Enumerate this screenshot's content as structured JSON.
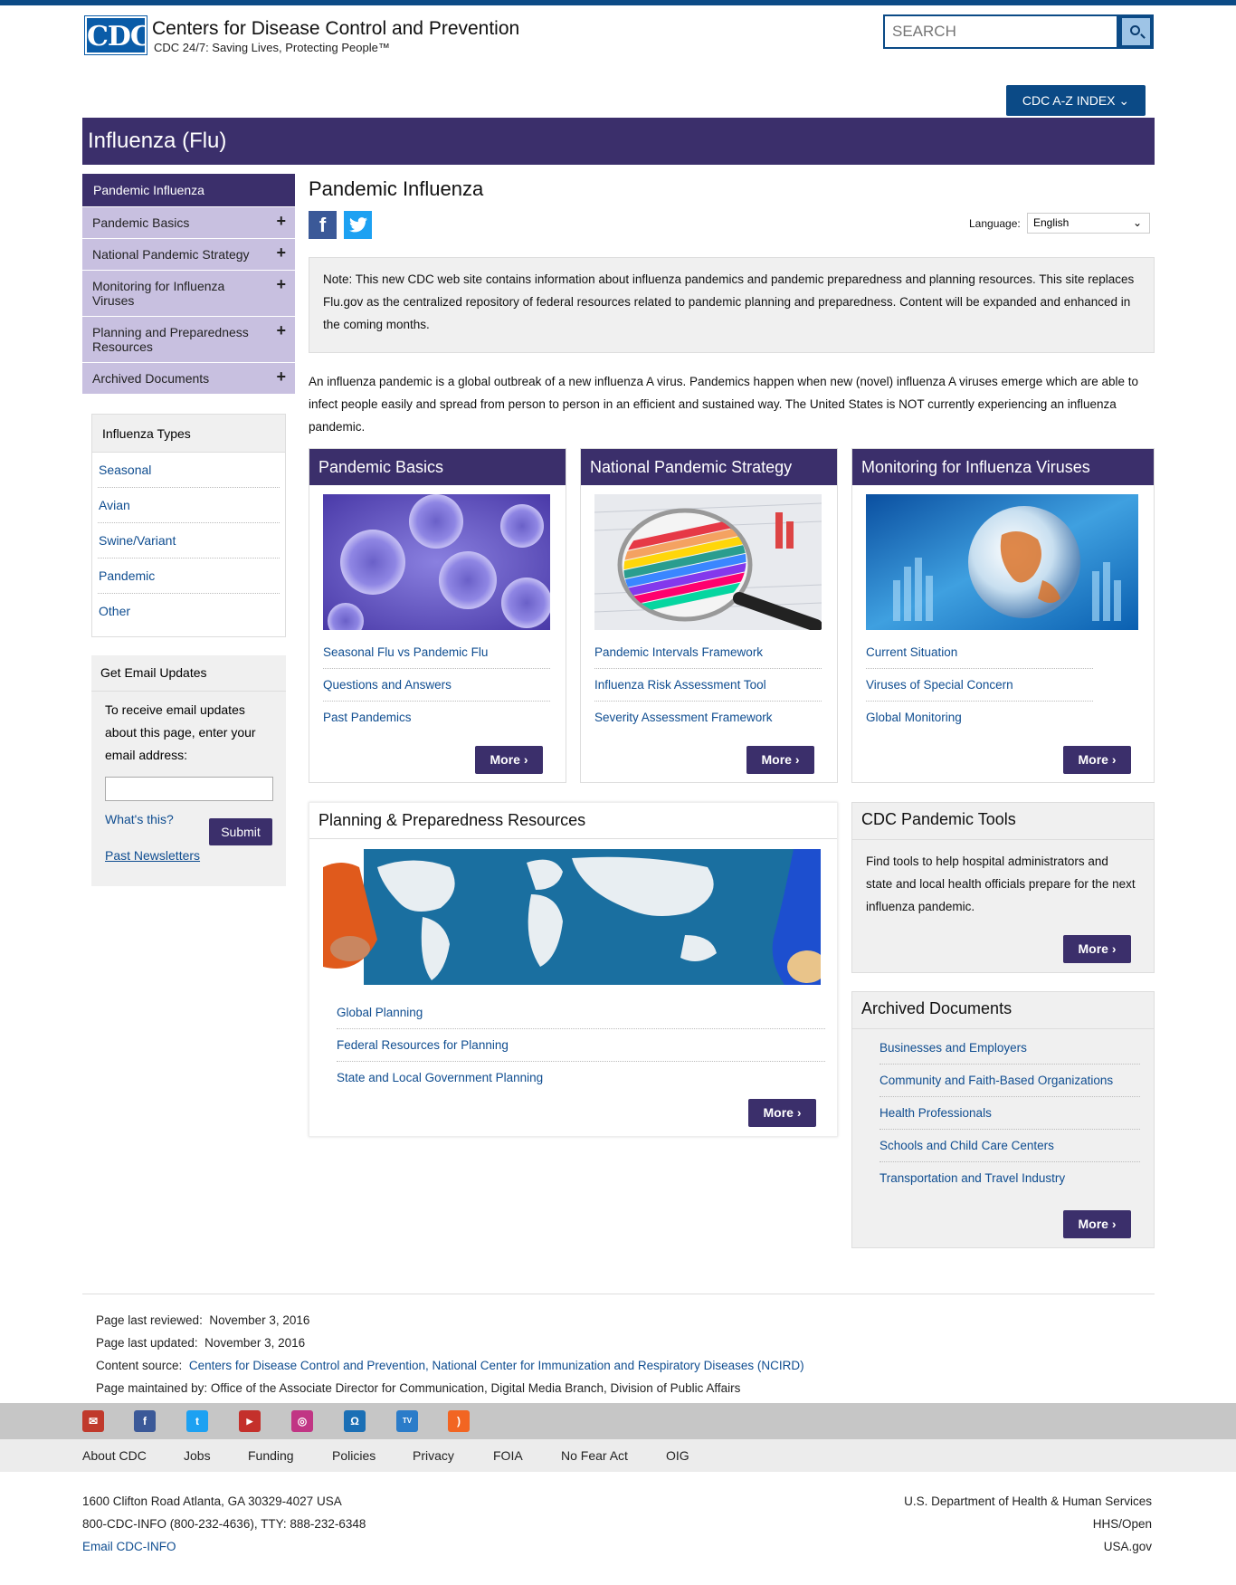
{
  "header": {
    "logo_text": "CDC",
    "org_name": "Centers for Disease Control and Prevention",
    "tagline": "CDC 24/7: Saving Lives, Protecting People™",
    "search_placeholder": "SEARCH",
    "az_index_label": "CDC A-Z INDEX"
  },
  "banner": {
    "title": "Influenza (Flu)"
  },
  "left_nav": {
    "active": "Pandemic Influenza",
    "items": [
      {
        "label": "Pandemic Basics"
      },
      {
        "label": "National Pandemic Strategy"
      },
      {
        "label": "Monitoring for Influenza Viruses"
      },
      {
        "label": "Planning and Preparedness Resources"
      },
      {
        "label": "Archived Documents"
      }
    ]
  },
  "influenza_types": {
    "heading": "Influenza Types",
    "links": [
      "Seasonal",
      "Avian",
      "Swine/Variant",
      "Pandemic",
      "Other"
    ]
  },
  "email_updates": {
    "heading": "Get Email Updates",
    "text": "To receive email updates about this page, enter your email address:",
    "whats_this": "What's this?",
    "submit": "Submit",
    "past_newsletters": "Past Newsletters"
  },
  "main": {
    "title": "Pandemic Influenza",
    "language_label": "Language:",
    "language_value": "English",
    "note": "Note: This new CDC web site contains information about influenza pandemics and pandemic preparedness and planning resources. This site replaces Flu.gov as the centralized repository of federal resources related to pandemic planning and preparedness. Content will be expanded and enhanced in the coming months.",
    "intro": "An influenza pandemic is a global outbreak of a new influenza A virus. Pandemics happen when new (novel) influenza A viruses emerge which are able to infect people easily and spread from person to person in an efficient and sustained way. The United States is NOT currently experiencing an influenza pandemic."
  },
  "cards": [
    {
      "title": "Pandemic Basics",
      "links": [
        "Seasonal Flu vs Pandemic Flu",
        "Questions and Answers",
        "Past Pandemics"
      ],
      "more": "More"
    },
    {
      "title": "National Pandemic Strategy",
      "links": [
        "Pandemic Intervals Framework",
        "Influenza Risk Assessment Tool",
        "Severity Assessment Framework"
      ],
      "more": "More"
    },
    {
      "title": "Monitoring for Influenza Viruses",
      "links": [
        "Current Situation",
        "Viruses of Special Concern",
        "Global Monitoring"
      ],
      "more": "More"
    }
  ],
  "planning": {
    "title": "Planning & Preparedness Resources",
    "links": [
      "Global Planning",
      "Federal Resources for Planning",
      "State and Local Government Planning"
    ],
    "more": "More"
  },
  "tools": {
    "title": "CDC Pandemic Tools",
    "text": "Find tools to help hospital administrators and state and local health officials prepare for the next influenza pandemic.",
    "more": "More"
  },
  "archived": {
    "title": "Archived Documents",
    "links": [
      "Businesses and Employers",
      "Community and Faith-Based Organizations",
      "Health Professionals",
      "Schools and Child Care Centers",
      "Transportation and Travel Industry"
    ],
    "more": "More"
  },
  "page_meta": {
    "reviewed_label": "Page last reviewed:",
    "reviewed": "November 3, 2016",
    "updated_label": "Page last updated:",
    "updated": "November 3, 2016",
    "source_label": "Content source:",
    "source": "Centers for Disease Control and Prevention, National Center for Immunization and Respiratory Diseases (NCIRD)",
    "maintained_label": "Page maintained by:",
    "maintained": "Office of the Associate Director for Communication, Digital Media Branch, Division of Public Affairs"
  },
  "footer": {
    "social_icons": [
      "email-icon",
      "facebook-icon",
      "twitter-icon",
      "youtube-icon",
      "instagram-icon",
      "podcast-icon",
      "cdc-tv-icon",
      "rss-icon"
    ],
    "links": [
      "About CDC",
      "Jobs",
      "Funding",
      "Policies",
      "Privacy",
      "FOIA",
      "No Fear Act",
      "OIG"
    ],
    "address": "1600 Clifton Road Atlanta, GA 30329-4027 USA",
    "phone": "800-CDC-INFO (800-232-4636), TTY: 888-232-6348",
    "email_link": "Email CDC-INFO",
    "hhs": "U.S. Department of Health & Human Services",
    "hhs_open": "HHS/Open",
    "usagov": "USA.gov"
  },
  "colors": {
    "brand_blue": "#0b4a86",
    "purple": "#3b2f6b",
    "nav_lavender": "#c8c0e0",
    "link": "#0f4d90"
  }
}
